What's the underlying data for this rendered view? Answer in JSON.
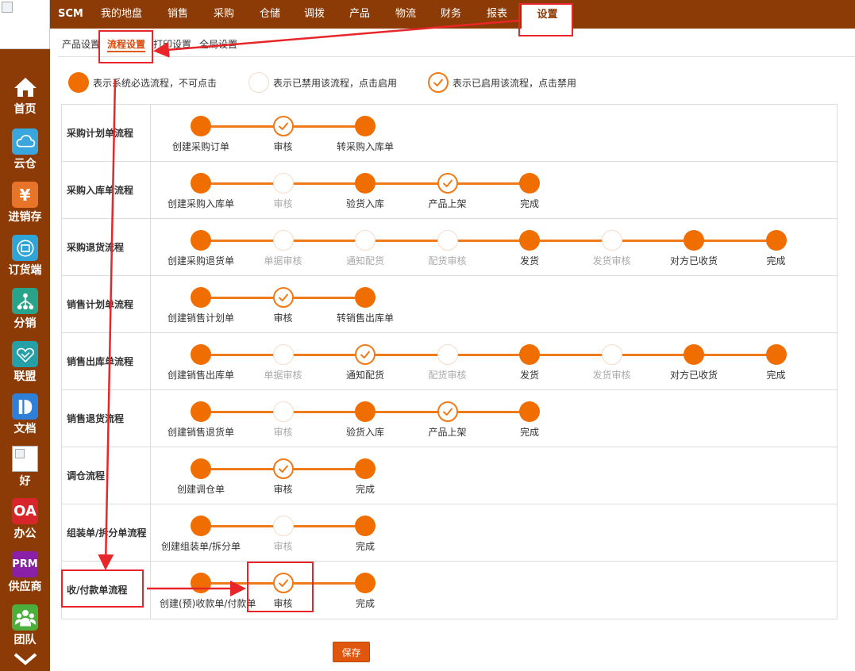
{
  "nav": {
    "brand": "SCM",
    "items": [
      "我的地盘",
      "销售",
      "采购",
      "仓储",
      "调拨",
      "产品",
      "物流",
      "财务",
      "报表"
    ],
    "active": "设置"
  },
  "subtabs": {
    "items": [
      "产品设置",
      "流程设置",
      "打印设置",
      "全局设置"
    ],
    "active_index": 1
  },
  "sidebar": {
    "items": [
      {
        "label": "首页",
        "icon": "home-icon",
        "color": "#8c3b06"
      },
      {
        "label": "云仓",
        "icon": "cloud-icon",
        "color": "#3aa6de"
      },
      {
        "label": "进销存",
        "icon": "yen-icon",
        "color": "#e8742a"
      },
      {
        "label": "订货端",
        "icon": "order-icon",
        "color": "#2ea5d6"
      },
      {
        "label": "分销",
        "icon": "distribution-icon",
        "color": "#2aa38b"
      },
      {
        "label": "联盟",
        "icon": "handshake-icon",
        "color": "#25a0a8"
      },
      {
        "label": "文档",
        "icon": "document-icon",
        "color": "#2d7fd8"
      },
      {
        "label": "好",
        "icon": "broken-image-icon",
        "color": "#ffffff"
      },
      {
        "label": "办公",
        "icon": "oa-icon",
        "color": "#d7262b",
        "text": "OA"
      },
      {
        "label": "供应商",
        "icon": "prm-icon",
        "color": "#8a1fa8",
        "text": "PRM"
      },
      {
        "label": "团队",
        "icon": "team-icon",
        "color": "#4caf3c"
      }
    ]
  },
  "legend": [
    {
      "state": "required",
      "text": "表示系统必选流程，不可点击"
    },
    {
      "state": "disabled",
      "text": "表示已禁用该流程，点击启用"
    },
    {
      "state": "enabled",
      "text": "表示已启用该流程，点击禁用"
    }
  ],
  "flows": [
    {
      "name": "采购计划单流程",
      "steps": [
        {
          "label": "创建采购订单",
          "state": "required"
        },
        {
          "label": "审核",
          "state": "enabled"
        },
        {
          "label": "转采购入库单",
          "state": "required"
        }
      ]
    },
    {
      "name": "采购入库单流程",
      "steps": [
        {
          "label": "创建采购入库单",
          "state": "required"
        },
        {
          "label": "审核",
          "state": "disabled"
        },
        {
          "label": "验货入库",
          "state": "required"
        },
        {
          "label": "产品上架",
          "state": "enabled"
        },
        {
          "label": "完成",
          "state": "required"
        }
      ]
    },
    {
      "name": "采购退货流程",
      "steps": [
        {
          "label": "创建采购退货单",
          "state": "required"
        },
        {
          "label": "单据审核",
          "state": "disabled"
        },
        {
          "label": "通知配货",
          "state": "disabled"
        },
        {
          "label": "配货审核",
          "state": "disabled"
        },
        {
          "label": "发货",
          "state": "required"
        },
        {
          "label": "发货审核",
          "state": "disabled"
        },
        {
          "label": "对方已收货",
          "state": "required"
        },
        {
          "label": "完成",
          "state": "required"
        }
      ]
    },
    {
      "name": "销售计划单流程",
      "steps": [
        {
          "label": "创建销售计划单",
          "state": "required"
        },
        {
          "label": "审核",
          "state": "enabled"
        },
        {
          "label": "转销售出库单",
          "state": "required"
        }
      ]
    },
    {
      "name": "销售出库单流程",
      "steps": [
        {
          "label": "创建销售出库单",
          "state": "required"
        },
        {
          "label": "单据审核",
          "state": "disabled"
        },
        {
          "label": "通知配货",
          "state": "enabled"
        },
        {
          "label": "配货审核",
          "state": "disabled"
        },
        {
          "label": "发货",
          "state": "required"
        },
        {
          "label": "发货审核",
          "state": "disabled"
        },
        {
          "label": "对方已收货",
          "state": "required"
        },
        {
          "label": "完成",
          "state": "required"
        }
      ]
    },
    {
      "name": "销售退货流程",
      "steps": [
        {
          "label": "创建销售退货单",
          "state": "required"
        },
        {
          "label": "审核",
          "state": "disabled"
        },
        {
          "label": "验货入库",
          "state": "required"
        },
        {
          "label": "产品上架",
          "state": "enabled"
        },
        {
          "label": "完成",
          "state": "required"
        }
      ]
    },
    {
      "name": "调仓流程",
      "steps": [
        {
          "label": "创建调仓单",
          "state": "required"
        },
        {
          "label": "审核",
          "state": "enabled"
        },
        {
          "label": "完成",
          "state": "required"
        }
      ]
    },
    {
      "name": "组装单/拆分单流程",
      "steps": [
        {
          "label": "创建组装单/拆分单",
          "state": "required"
        },
        {
          "label": "审核",
          "state": "disabled"
        },
        {
          "label": "完成",
          "state": "required"
        }
      ]
    },
    {
      "name": "收/付款单流程",
      "steps": [
        {
          "label": "创建(预)收款单/付款单",
          "state": "required"
        },
        {
          "label": "审核",
          "state": "enabled"
        },
        {
          "label": "完成",
          "state": "required"
        }
      ]
    }
  ],
  "save_label": "保存",
  "colors": {
    "brand": "#8c3b06",
    "accent": "#f06d00",
    "annotation": "#e8262a"
  }
}
